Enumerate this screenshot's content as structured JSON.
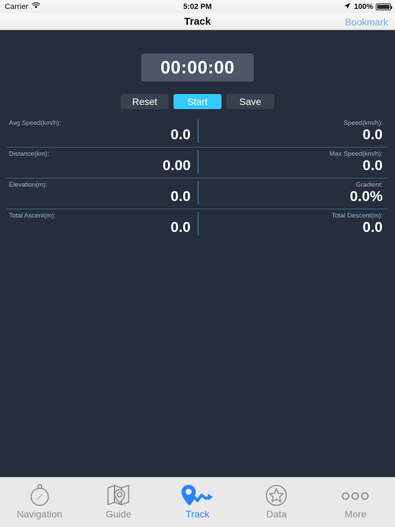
{
  "status_bar": {
    "carrier": "Carrier",
    "wifi_icon": "wifi-icon",
    "time": "5:02 PM",
    "location_icon": "location-arrow-icon",
    "battery_percent": "100%",
    "battery_icon": "battery-full-icon"
  },
  "nav_bar": {
    "title": "Track",
    "bookmark_label": "Bookmark"
  },
  "timer": {
    "value": "00:00:00"
  },
  "controls": {
    "reset_label": "Reset",
    "start_label": "Start",
    "save_label": "Save",
    "primary_color": "#35c9f9"
  },
  "stats": {
    "left": [
      {
        "label": "Avg Speed(km/h):",
        "value": "0.0"
      },
      {
        "label": "Distance(km):",
        "value": "0.00"
      },
      {
        "label": "Elevation(m):",
        "value": "0.0"
      },
      {
        "label": "Total Ascent(m):",
        "value": "0.0"
      }
    ],
    "right": [
      {
        "label": "Speed(km/h):",
        "value": "0.0"
      },
      {
        "label": "Max Speed(km/h):",
        "value": "0.0"
      },
      {
        "label": "Gradient:",
        "value": "0.0%"
      },
      {
        "label": "Total Descent(m):",
        "value": "0.0"
      }
    ]
  },
  "tab_bar": {
    "active_color": "#2d86f5",
    "inactive_color": "#8e8e8e",
    "items": [
      {
        "label": "Navigation",
        "icon": "compass-icon",
        "active": false
      },
      {
        "label": "Guide",
        "icon": "map-pin-icon",
        "active": false
      },
      {
        "label": "Track",
        "icon": "track-route-icon",
        "active": true
      },
      {
        "label": "Data",
        "icon": "star-circle-icon",
        "active": false
      },
      {
        "label": "More",
        "icon": "ellipsis-icon",
        "active": false
      }
    ]
  }
}
